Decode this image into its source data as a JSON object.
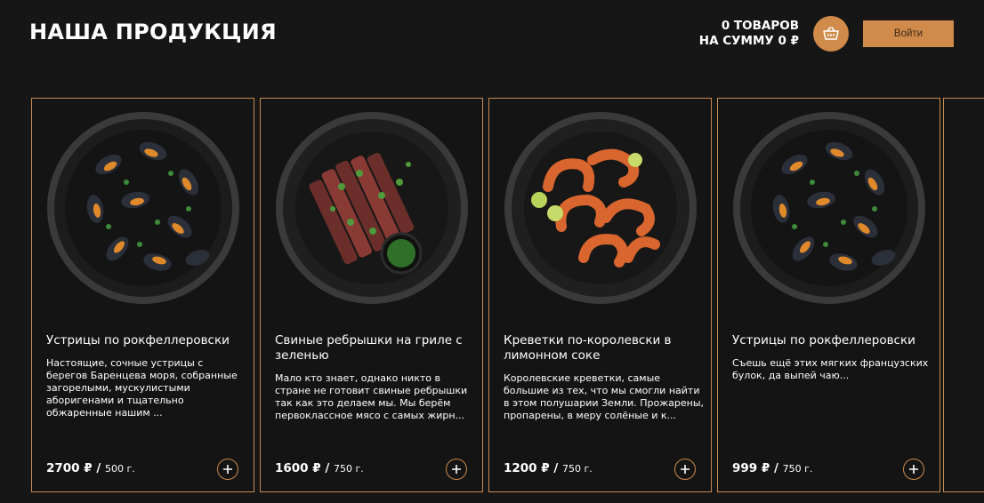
{
  "header": {
    "title": "НАША ПРОДУКЦИЯ",
    "cart_count": "0 ТОВАРОВ",
    "cart_sum": "НА СУММУ 0 ₽",
    "login_label": "Войти"
  },
  "colors": {
    "accent": "#d08a49",
    "background": "#161616",
    "card_border": "#c98a4e"
  },
  "products": [
    {
      "title": "Устрицы по рокфеллеровски",
      "description": "Настоящие, сочные устрицы с берегов Баренцева моря, собранные загорелыми, мускулистыми аборигенами и тщательно обжаренные нашим ...",
      "price": "2700 ₽ /",
      "weight": "500 г."
    },
    {
      "title": "Свиные ребрышки на гриле с зеленью",
      "description": "Мало кто знает, однако никто в стране не готовит свиные ребрышки так как это делаем мы. Мы берём первоклассное мясо с самых жирн...",
      "price": "1600 ₽ /",
      "weight": "750 г."
    },
    {
      "title": "Креветки по-королевски в лимонном соке",
      "description": "Королевские креветки, самые большие из тех, что мы смогли найти в этом полушарии Земли. Прожарены, пропарены, в меру солёные и к...",
      "price": "1200 ₽ /",
      "weight": "750 г."
    },
    {
      "title": "Устрицы по рокфеллеровски",
      "description": "Съешь ещё этих мягких французских булок, да выпей чаю...",
      "price": "999 ₽ /",
      "weight": "750 г."
    }
  ]
}
